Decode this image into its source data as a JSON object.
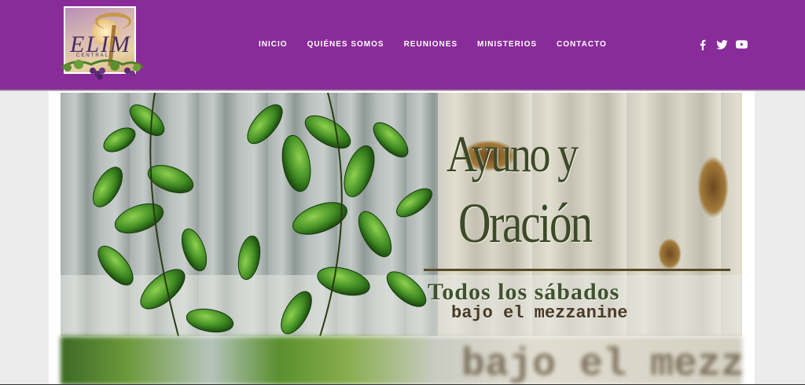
{
  "brand": {
    "logo_main": "ELIM",
    "logo_sub": "CENTRAL"
  },
  "nav": {
    "items": [
      {
        "label": "INICIO"
      },
      {
        "label": "QUIÉNES SOMOS"
      },
      {
        "label": "REUNIONES"
      },
      {
        "label": "MINISTERIOS"
      },
      {
        "label": "CONTACTO"
      }
    ]
  },
  "social": {
    "icons": [
      "facebook-icon",
      "twitter-icon",
      "youtube-icon"
    ]
  },
  "banner": {
    "title_line1": "Ayuno y",
    "title_line2": "Oración",
    "subtitle": "Todos los sábados",
    "location": "bajo el mezzanine",
    "blur_echo": "bajo el mezza"
  },
  "colors": {
    "header": "#8a2b9a",
    "title": "#3d4a28"
  }
}
